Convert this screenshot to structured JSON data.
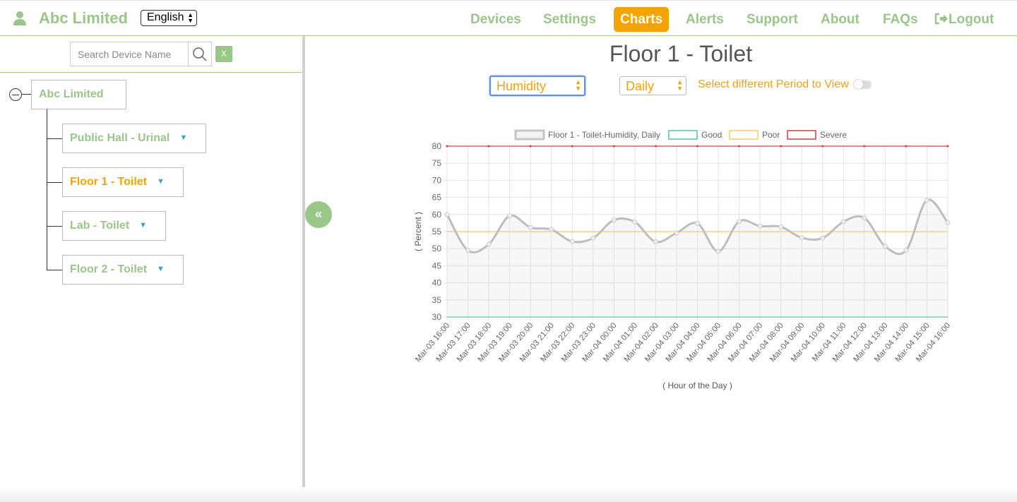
{
  "header": {
    "brand": "Abc Limited",
    "language": "English",
    "nav": [
      {
        "label": "Devices",
        "active": false
      },
      {
        "label": "Settings",
        "active": false
      },
      {
        "label": "Charts",
        "active": true
      },
      {
        "label": "Alerts",
        "active": false
      },
      {
        "label": "Support",
        "active": false
      },
      {
        "label": "About",
        "active": false
      },
      {
        "label": "FAQs",
        "active": false
      },
      {
        "label": "Logout",
        "active": false
      }
    ]
  },
  "sidebar": {
    "search_placeholder": "Search Device Name",
    "clear_label": "X",
    "root": "Abc Limited",
    "devices": [
      "Public Hall - Urinal",
      "Floor 1 - Toilet",
      "Lab - Toilet",
      "Floor 2 - Toilet"
    ],
    "selected_device": "Floor 1 - Toilet",
    "collapse_label": "«"
  },
  "main": {
    "title": "Floor 1 - Toilet",
    "metric": "Humidity",
    "period": "Daily",
    "period_label": "Select different Period to View"
  },
  "colors": {
    "brand_green": "#98c787",
    "accent_orange": "#f5a300",
    "series_grey": "#bdbdbd",
    "good": "#4dc9a0",
    "poor": "#ffc760",
    "severe": "#e03b3b"
  },
  "chart_data": {
    "type": "line",
    "xlabel": "( Hour of the Day )",
    "ylabel": "( Percent )",
    "ylim": [
      30,
      80
    ],
    "yticks": [
      30,
      35,
      40,
      45,
      50,
      55,
      60,
      65,
      70,
      75,
      80
    ],
    "grid": true,
    "legend_position": "top",
    "x": [
      "Mar-03 16:00",
      "Mar-03 17:00",
      "Mar-03 18:00",
      "Mar-03 19:00",
      "Mar-03 20:00",
      "Mar-03 21:00",
      "Mar-03 22:00",
      "Mar-03 23:00",
      "Mar-04 00:00",
      "Mar-04 01:00",
      "Mar-04 02:00",
      "Mar-04 03:00",
      "Mar-04 04:00",
      "Mar-04 05:00",
      "Mar-04 06:00",
      "Mar-04 07:00",
      "Mar-04 08:00",
      "Mar-04 09:00",
      "Mar-04 10:00",
      "Mar-04 11:00",
      "Mar-04 12:00",
      "Mar-04 13:00",
      "Mar-04 14:00",
      "Mar-04 15:00",
      "Mar-04 16:00"
    ],
    "series": [
      {
        "name": "Floor 1 - Toilet-Humidity, Daily",
        "values": [
          60,
          49.5,
          51.3,
          59.6,
          56.2,
          55.6,
          52.1,
          53.1,
          58.4,
          57.8,
          52,
          54.6,
          57.4,
          49.2,
          58,
          56.6,
          56.4,
          53.2,
          53.1,
          57.9,
          59,
          50.7,
          49.5,
          64.2,
          57.6
        ]
      },
      {
        "name": "Good",
        "values": [
          30,
          30,
          30,
          30,
          30,
          30,
          30,
          30,
          30,
          30,
          30,
          30,
          30,
          30,
          30,
          30,
          30,
          30,
          30,
          30,
          30,
          30,
          30,
          30,
          30
        ]
      },
      {
        "name": "Poor",
        "values": [
          55,
          55,
          55,
          55,
          55,
          55,
          55,
          55,
          55,
          55,
          55,
          55,
          55,
          55,
          55,
          55,
          55,
          55,
          55,
          55,
          55,
          55,
          55,
          55,
          55
        ]
      },
      {
        "name": "Severe",
        "values": [
          80,
          80,
          80,
          80,
          80,
          80,
          80,
          80,
          80,
          80,
          80,
          80,
          80,
          80,
          80,
          80,
          80,
          80,
          80,
          80,
          80,
          80,
          80,
          80,
          80
        ]
      }
    ]
  }
}
